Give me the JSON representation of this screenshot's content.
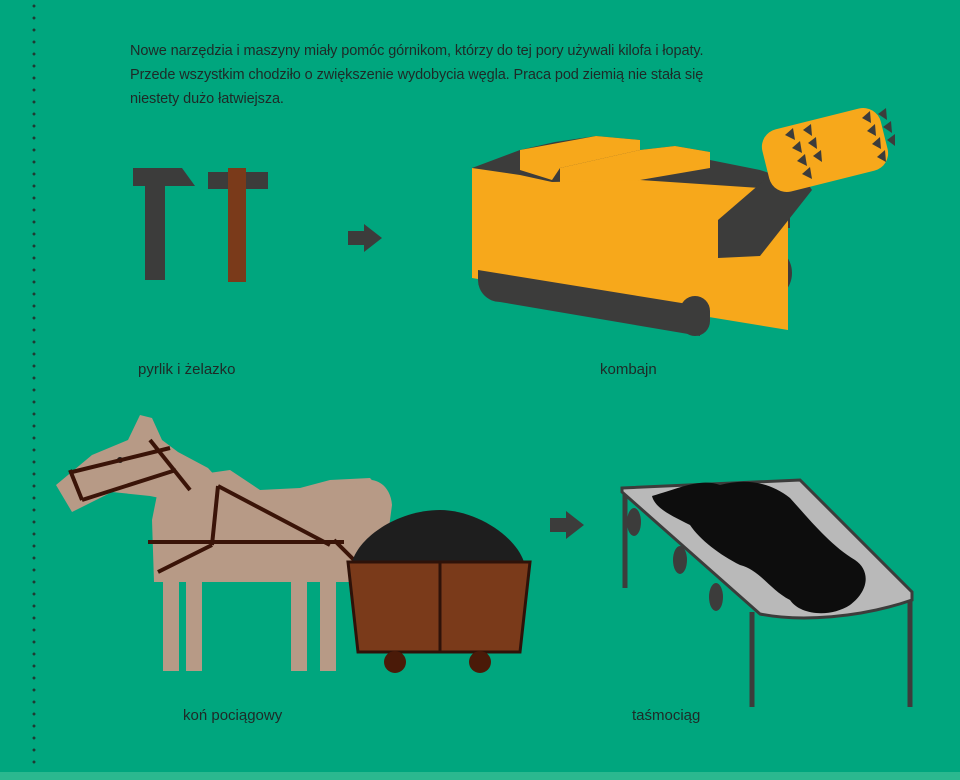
{
  "intro": {
    "line1": "Nowe narzędzia i maszyny miały pomóc górnikom, którzy do tej pory używali kilofa i łopaty.",
    "line2": "Przede wszystkim chodziło o zwiększenie wydobycia węgla. Praca pod ziemią nie stała się",
    "line3": "niestety dużo łatwiejsza."
  },
  "captions": {
    "tools": "pyrlik i żelazko",
    "combine": "kombajn",
    "horse": "koń pociągowy",
    "conveyor": "taśmociąg"
  },
  "colors": {
    "background": "#00a67e",
    "combine_yellow": "#f7a81b",
    "dark_grey": "#3c3c3b",
    "horse": "#b79a86",
    "cart": "#7a3a1a",
    "conveyor": "#b9b9b9"
  }
}
